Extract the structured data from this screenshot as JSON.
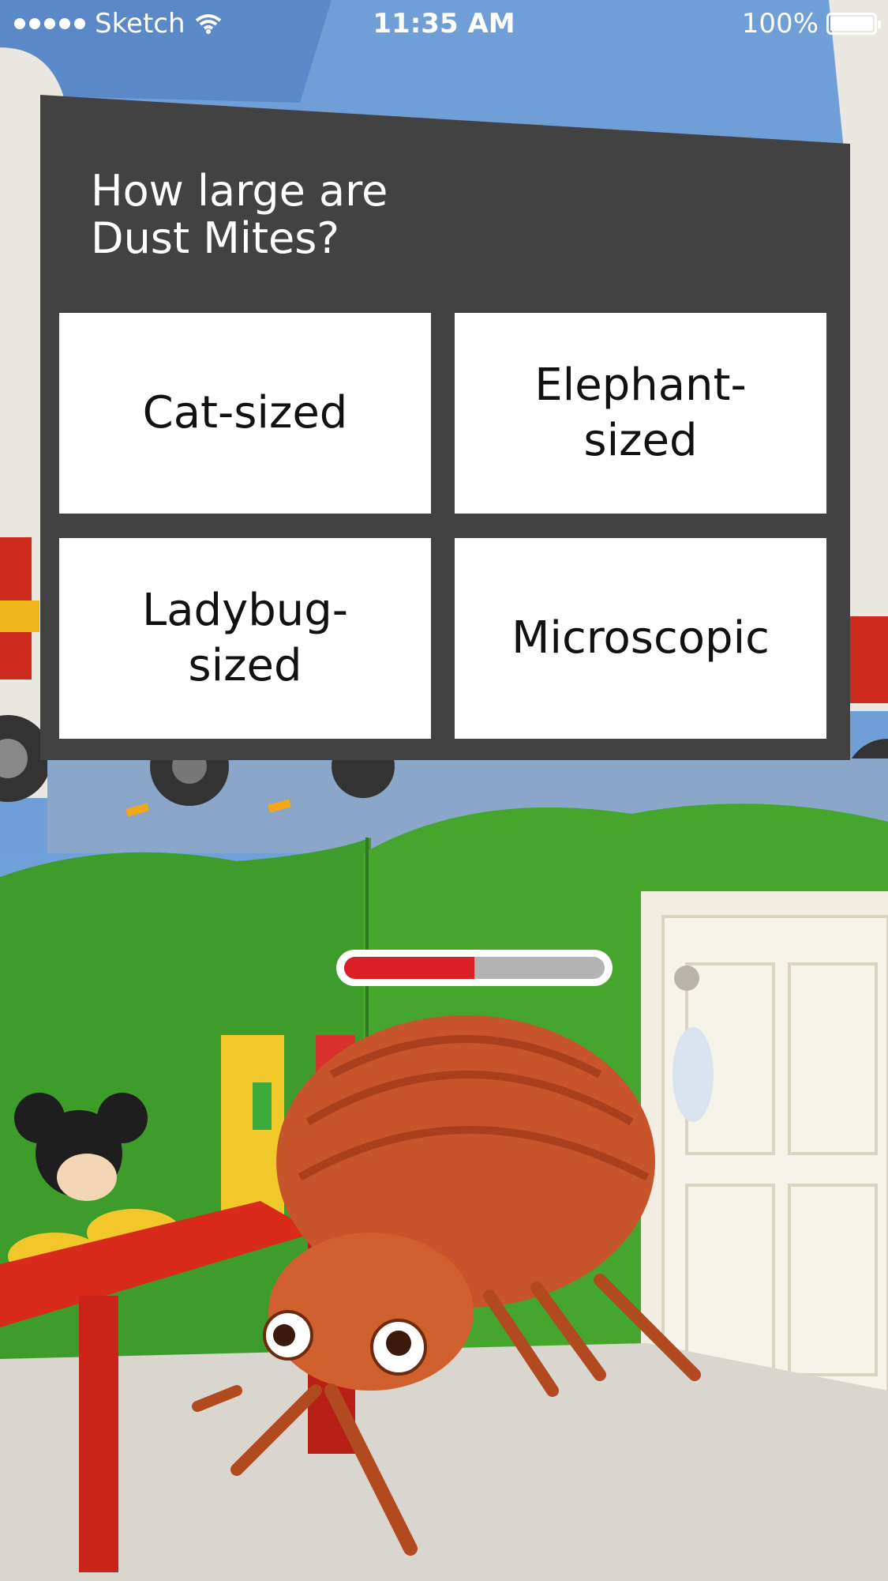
{
  "status_bar": {
    "carrier": "Sketch",
    "time": "11:35 AM",
    "battery_percent": "100%"
  },
  "quiz": {
    "question_line1": "How large are",
    "question_line2": "Dust Mites?",
    "answers": [
      {
        "line1": "Cat-sized",
        "line2": ""
      },
      {
        "line1": "Elephant-",
        "line2": "sized"
      },
      {
        "line1": "Ladybug-",
        "line2": "sized"
      },
      {
        "line1": "Microscopic",
        "line2": ""
      }
    ]
  },
  "progress": {
    "fraction": 0.5,
    "fill_color": "#d81f26",
    "track_color": "#b3b3b3"
  },
  "colors": {
    "panel": "#424242",
    "answer_bg": "#ffffff"
  },
  "icons": [
    "signal-dots-icon",
    "wifi-icon",
    "battery-icon",
    "bed-bug-character"
  ]
}
